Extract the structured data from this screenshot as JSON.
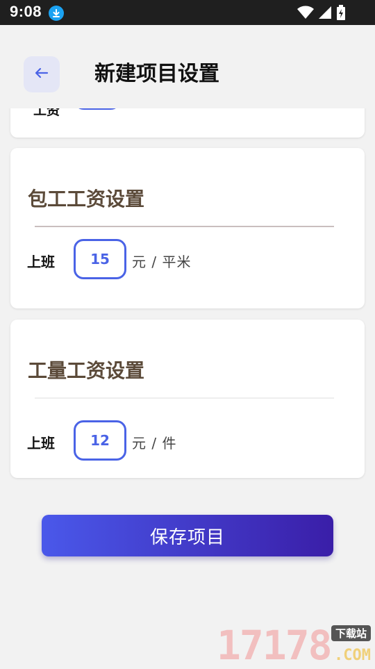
{
  "status_bar": {
    "time": "9:08"
  },
  "header": {
    "title": "新建项目设置"
  },
  "partial_section": {
    "label": "工资"
  },
  "contract_section": {
    "title": "包工工资设置",
    "row_label": "上班",
    "value": "15",
    "unit": "元 / 平米",
    "divider_color": "#c9bebe"
  },
  "piece_section": {
    "title": "工量工资设置",
    "row_label": "上班",
    "value": "12",
    "unit": "元 / 件",
    "divider_color": "#eeeeee"
  },
  "save_button": {
    "label": "保存项目"
  },
  "watermark": {
    "digits": "17178",
    "tag": "下载站",
    "domain": ".COM"
  },
  "colors": {
    "accent": "#4a63e6",
    "title_brown": "#5b4a39",
    "button_gradient_start": "#4a58ea",
    "button_gradient_end": "#3a1ea8"
  }
}
